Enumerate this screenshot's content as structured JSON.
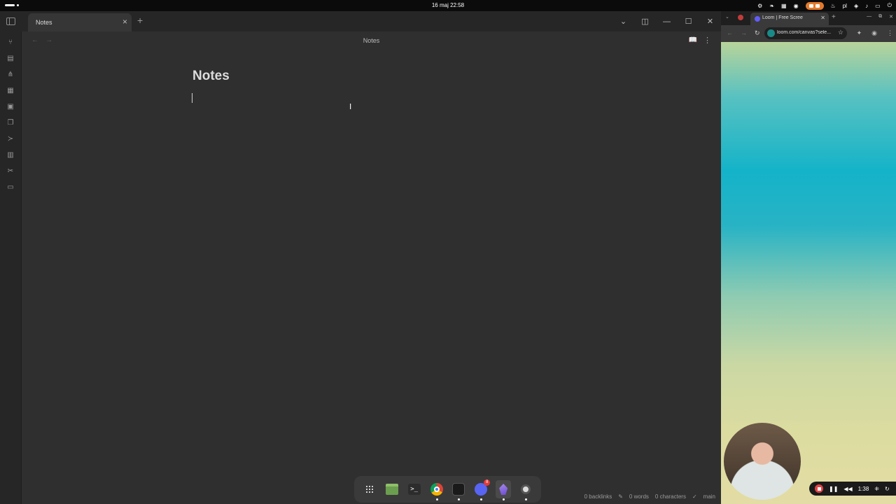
{
  "system": {
    "clock": "16 maj  22:58",
    "language": "pl"
  },
  "obsidian": {
    "tab_title": "Notes",
    "new_tab_icon": "plus-icon",
    "view_title": "Notes",
    "note_title": "Notes",
    "ribbon_icons": [
      "git-icon",
      "page-icon",
      "graph-icon",
      "grid-icon",
      "calendar-icon",
      "copy-icon",
      "terminal-icon",
      "presentation-icon",
      "tools-icon",
      "chat-icon"
    ],
    "status": {
      "backlinks": "0 backlinks",
      "words": "0 words",
      "characters": "0 characters",
      "branch": "main"
    }
  },
  "dock": {
    "discord_badge": "8",
    "apps": [
      "apps-grid",
      "files",
      "terminal",
      "chrome",
      "cube",
      "discord",
      "obsidian",
      "settings"
    ]
  },
  "browser": {
    "tab_title": "Loom | Free Scree",
    "url": "loom.com/canvas?sele...",
    "recording_time": "1:38"
  },
  "colors": {
    "editor_bg": "#2f2f2f",
    "chrome_bg": "#262626",
    "accent_record": "#e37a2b",
    "loom_purple": "#625df5"
  }
}
